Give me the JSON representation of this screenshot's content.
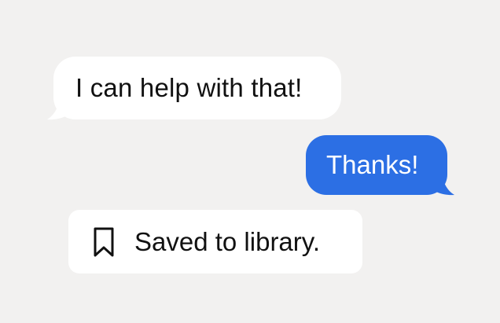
{
  "messages": [
    {
      "direction": "incoming",
      "text": "I can help with that!"
    },
    {
      "direction": "outgoing",
      "text": "Thanks!"
    }
  ],
  "saved_notice": {
    "icon": "bookmark-icon",
    "text": "Saved to library."
  },
  "colors": {
    "background": "#f2f1f0",
    "incoming_bubble": "#ffffff",
    "outgoing_bubble": "#2c6fe4",
    "outgoing_text": "#ffffff",
    "text": "#111111"
  }
}
